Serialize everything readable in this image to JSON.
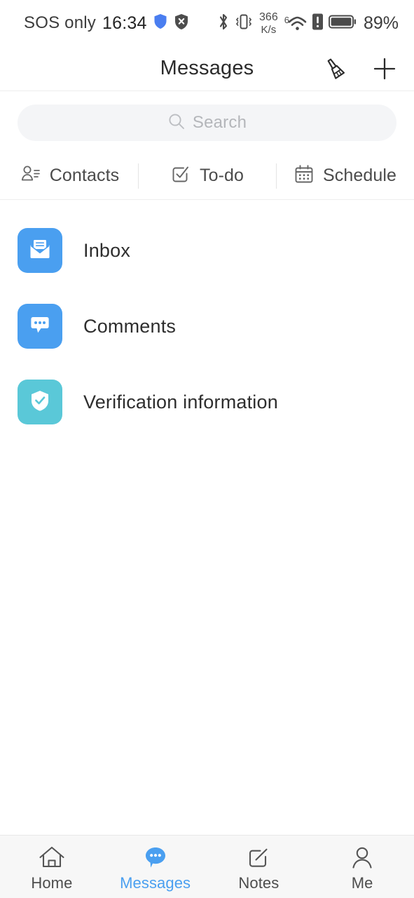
{
  "colors": {
    "accent": "#4a9ff0",
    "tile_blue": "#4a9ff0",
    "tile_teal": "#5ac8d8",
    "search_bg": "#f4f5f7",
    "tabbar_bg": "#f7f7f7",
    "text_primary": "#2e2e2e",
    "text_muted": "#b4b6ba"
  },
  "status_bar": {
    "carrier": "SOS only",
    "time": "16:34",
    "icons_left": [
      "shield-blue-icon",
      "shield-x-icon"
    ],
    "icons_right": [
      "bluetooth-icon",
      "vibrate-icon",
      "wifi-icon",
      "alert-icon",
      "battery-icon"
    ],
    "network_speed_value": "366",
    "network_speed_unit": "K/s",
    "wifi_generation": "6",
    "battery_percent": "89%"
  },
  "header": {
    "title": "Messages",
    "clean_label": "Clean up",
    "add_label": "New"
  },
  "search": {
    "placeholder": "Search",
    "value": ""
  },
  "quick_actions": [
    {
      "label": "Contacts",
      "icon": "contacts-icon"
    },
    {
      "label": "To-do",
      "icon": "todo-icon"
    },
    {
      "label": "Schedule",
      "icon": "schedule-icon"
    }
  ],
  "list": [
    {
      "label": "Inbox",
      "icon": "envelope-icon",
      "color": "#4a9ff0"
    },
    {
      "label": "Comments",
      "icon": "comment-bubble-icon",
      "color": "#4a9ff0"
    },
    {
      "label": "Verification information",
      "icon": "shield-check-icon",
      "color": "#5ac8d8"
    }
  ],
  "tabs": [
    {
      "label": "Home",
      "icon": "home-icon",
      "active": false
    },
    {
      "label": "Messages",
      "icon": "messages-icon",
      "active": true
    },
    {
      "label": "Notes",
      "icon": "notes-icon",
      "active": false
    },
    {
      "label": "Me",
      "icon": "profile-icon",
      "active": false
    }
  ]
}
